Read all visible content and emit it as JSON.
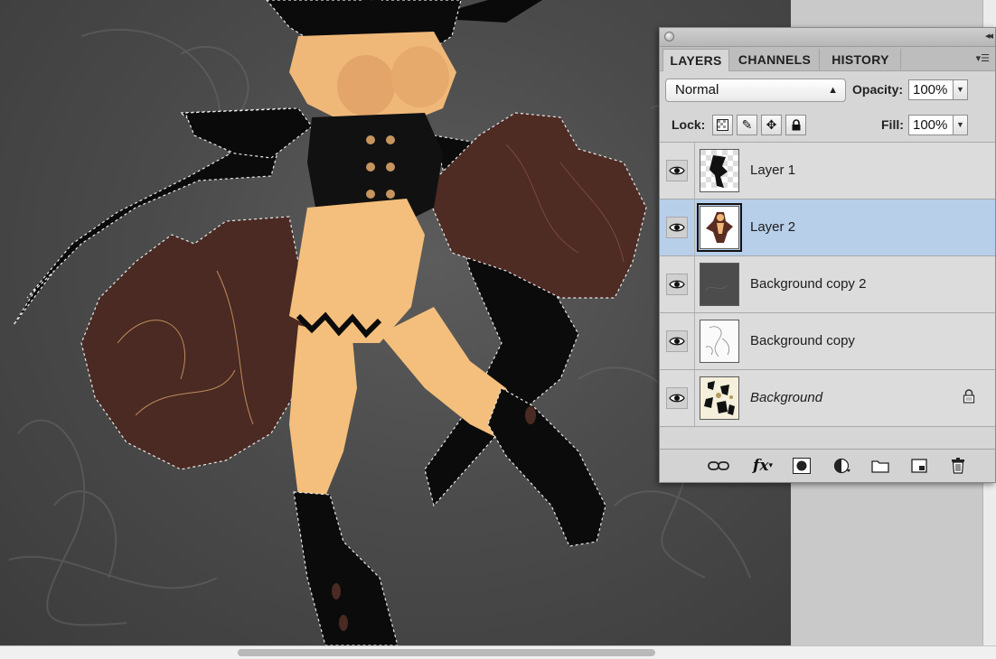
{
  "panel": {
    "tabs": [
      {
        "label": "LAYERS",
        "active": true
      },
      {
        "label": "CHANNELS",
        "active": false
      },
      {
        "label": "HISTORY",
        "active": false
      }
    ],
    "blend_mode": "Normal",
    "opacity_label": "Opacity:",
    "opacity_value": "100%",
    "lock_label": "Lock:",
    "fill_label": "Fill:",
    "fill_value": "100%",
    "layers": [
      {
        "name": "Layer 1",
        "visible": true,
        "selected": false,
        "italic": false,
        "locked": false
      },
      {
        "name": "Layer 2",
        "visible": true,
        "selected": true,
        "italic": false,
        "locked": false
      },
      {
        "name": "Background copy 2",
        "visible": true,
        "selected": false,
        "italic": false,
        "locked": false
      },
      {
        "name": "Background copy",
        "visible": true,
        "selected": false,
        "italic": false,
        "locked": false
      },
      {
        "name": "Background",
        "visible": true,
        "selected": false,
        "italic": true,
        "locked": true
      }
    ],
    "footer_icons": [
      "link-layers-icon",
      "fx-icon",
      "layer-mask-icon",
      "adjustment-layer-icon",
      "new-group-icon",
      "new-layer-icon",
      "trash-icon"
    ],
    "fx_label": "fx"
  },
  "colors": {
    "selection_highlight": "#b8cfea",
    "skin": "#f4bf7c",
    "dress": "#4a2a22",
    "canvas": "#4b4b4b"
  }
}
